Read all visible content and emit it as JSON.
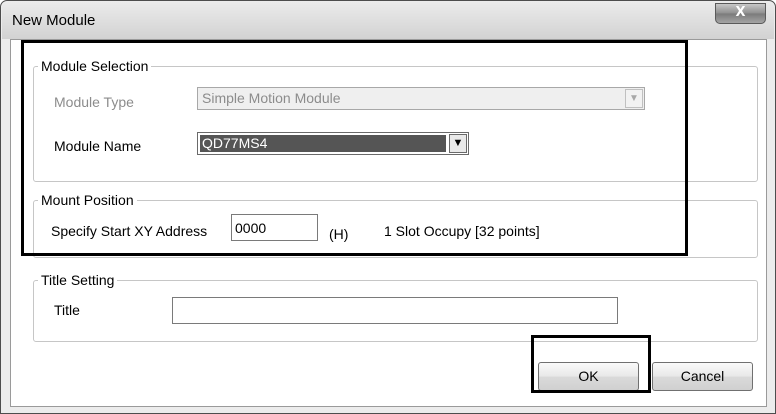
{
  "window": {
    "title": "New Module",
    "close_glyph": "X"
  },
  "module_selection": {
    "legend": "Module Selection",
    "module_type_label": "Module Type",
    "module_type_value": "Simple Motion Module",
    "module_name_label": "Module Name",
    "module_name_value": "QD77MS4"
  },
  "mount_position": {
    "legend": "Mount Position",
    "start_address_label": "Specify Start XY Address",
    "start_address_value": "0000",
    "hex_suffix": "(H)",
    "slot_info": "1 Slot Occupy [32 points]"
  },
  "title_setting": {
    "legend": "Title Setting",
    "title_label": "Title",
    "title_value": ""
  },
  "buttons": {
    "ok": "OK",
    "cancel": "Cancel"
  },
  "icons": {
    "close": "close-icon",
    "dropdown": "chevron-down-icon"
  },
  "colors": {
    "highlight_border": "#000000",
    "selected_field": "#555555"
  }
}
